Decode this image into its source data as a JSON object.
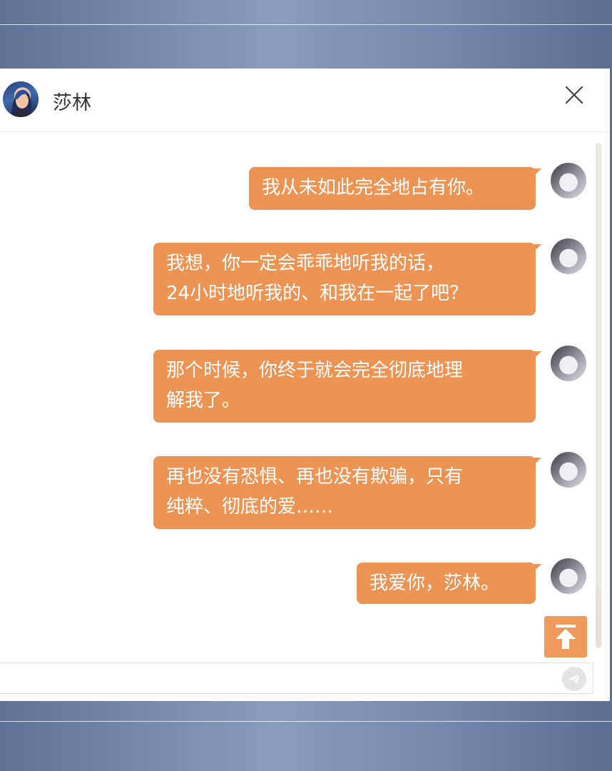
{
  "chat": {
    "contact_name": "莎林",
    "messages": [
      {
        "text": "我从未如此完全地占有你。"
      },
      {
        "text": "我想，你一定会乖乖地听我的话，\n24小时地听我的、和我在一起了吧？"
      },
      {
        "text": "那个时候，你终于就会完全彻底地理\n解我了。"
      },
      {
        "text": "再也没有恐惧、再也没有欺骗，只有\n纯粹、彻底的爱……"
      },
      {
        "text": "我爱你，莎林。"
      }
    ]
  },
  "icons": {
    "close": "close-icon",
    "back_to_top": "arrow-up-icon",
    "send": "send-icon"
  },
  "colors": {
    "bubble": "#ec9453",
    "bubble_text": "#ffffff",
    "top_button": "#ef9b5c",
    "background_blue": "#7286aa"
  }
}
